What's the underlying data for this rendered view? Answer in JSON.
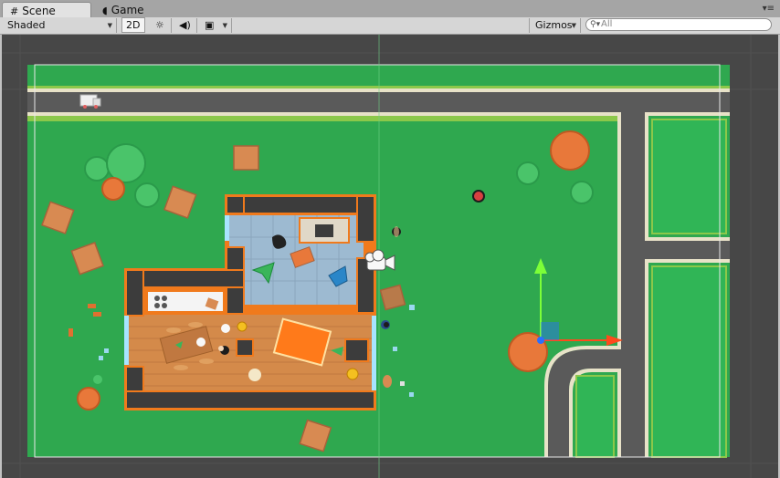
{
  "tabs": [
    {
      "label": "Scene",
      "icon": "grid-icon",
      "active": true
    },
    {
      "label": "Game",
      "icon": "pacman-icon",
      "active": false
    }
  ],
  "toolbar": {
    "shading_mode": "Shaded",
    "mode_2d": "2D",
    "lighting_icon": "sun-icon",
    "audio_icon": "speaker-icon",
    "effects_icon": "image-icon",
    "gizmos_label": "Gizmos",
    "search_placeholder": "All"
  },
  "colors": {
    "grass": "#2fa84f",
    "road": "#5a5a5a",
    "wall": "#3c3c3c",
    "wall_border": "#f07a1c",
    "floor_wood": "#d48a4a",
    "floor_tile": "#9dbad1",
    "gizmo_x": "#ff4a1c",
    "gizmo_y": "#7dff38",
    "gizmo_z": "#2a6fff"
  }
}
